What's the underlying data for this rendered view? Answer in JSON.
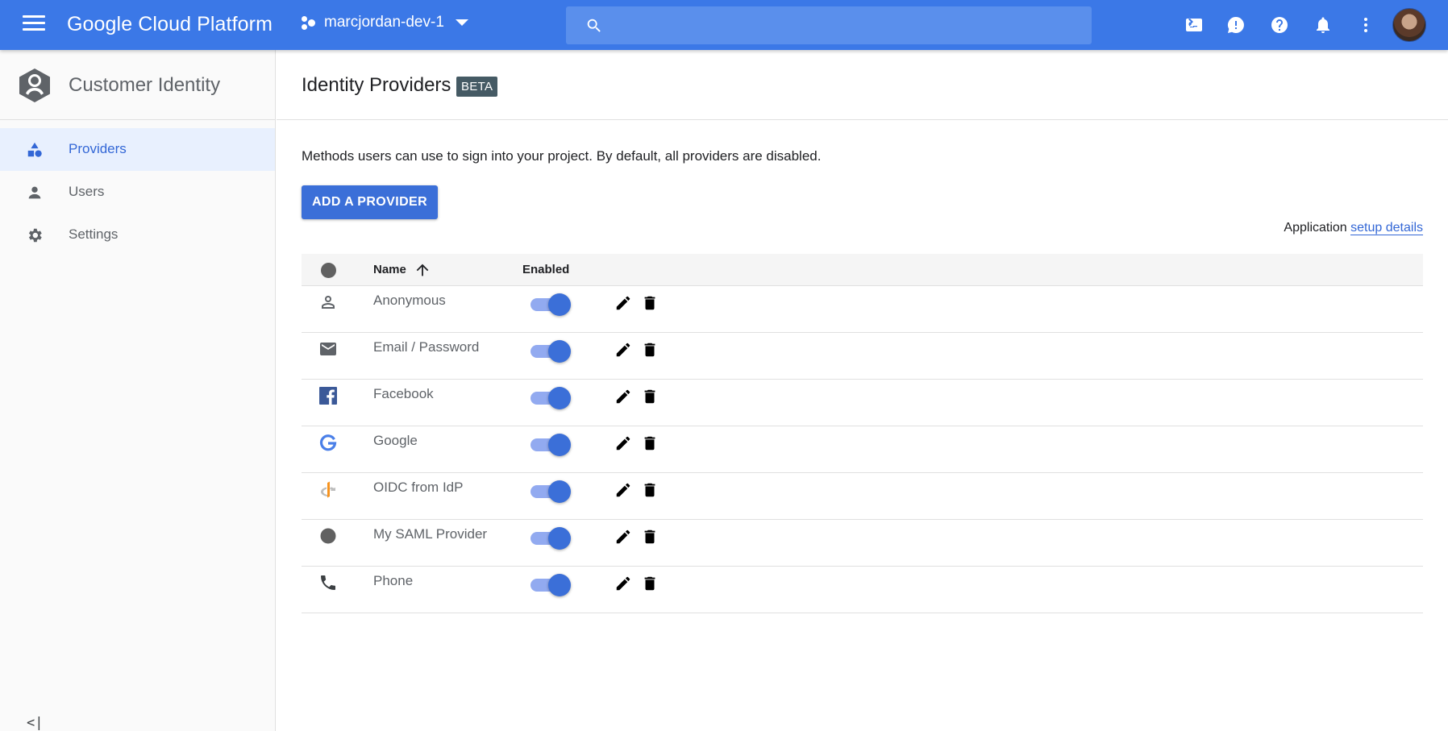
{
  "topbar": {
    "product_name": "Google Cloud Platform",
    "project": "marcjordan-dev-1",
    "search_placeholder": "",
    "icons": [
      "menu-icon",
      "project-icon",
      "caret-down-icon",
      "search-icon",
      "cloud-shell-icon",
      "feedback-icon",
      "help-icon",
      "notifications-icon",
      "more-vert-icon",
      "account-avatar"
    ],
    "color": "#3b78e7"
  },
  "sidebar": {
    "title": "Customer Identity",
    "items": [
      {
        "label": "Providers",
        "icon": "shapes-icon",
        "active": true
      },
      {
        "label": "Users",
        "icon": "person-icon",
        "active": false
      },
      {
        "label": "Settings",
        "icon": "gear-icon",
        "active": false
      }
    ],
    "collapse_label": "<|"
  },
  "main": {
    "title": "Identity Providers",
    "badge": "BETA",
    "description": "Methods users can use to sign into your project. By default, all providers are disabled.",
    "add_button": "ADD A PROVIDER",
    "setup_prefix": "Application",
    "setup_link": "setup details",
    "table": {
      "columns": [
        "Name",
        "Enabled"
      ],
      "sort": "ascending",
      "rows": [
        {
          "name": "Anonymous",
          "icon": "person-outline-icon",
          "enabled": true
        },
        {
          "name": "Email / Password",
          "icon": "email-icon",
          "enabled": true
        },
        {
          "name": "Facebook",
          "icon": "facebook-icon",
          "enabled": true
        },
        {
          "name": "Google",
          "icon": "google-icon",
          "enabled": true
        },
        {
          "name": "OIDC from IdP",
          "icon": "openid-icon",
          "enabled": true
        },
        {
          "name": "My SAML Provider",
          "icon": "saml-dot-icon",
          "enabled": true
        },
        {
          "name": "Phone",
          "icon": "phone-icon",
          "enabled": true
        }
      ]
    },
    "accent_color": "#3b6fd8"
  }
}
